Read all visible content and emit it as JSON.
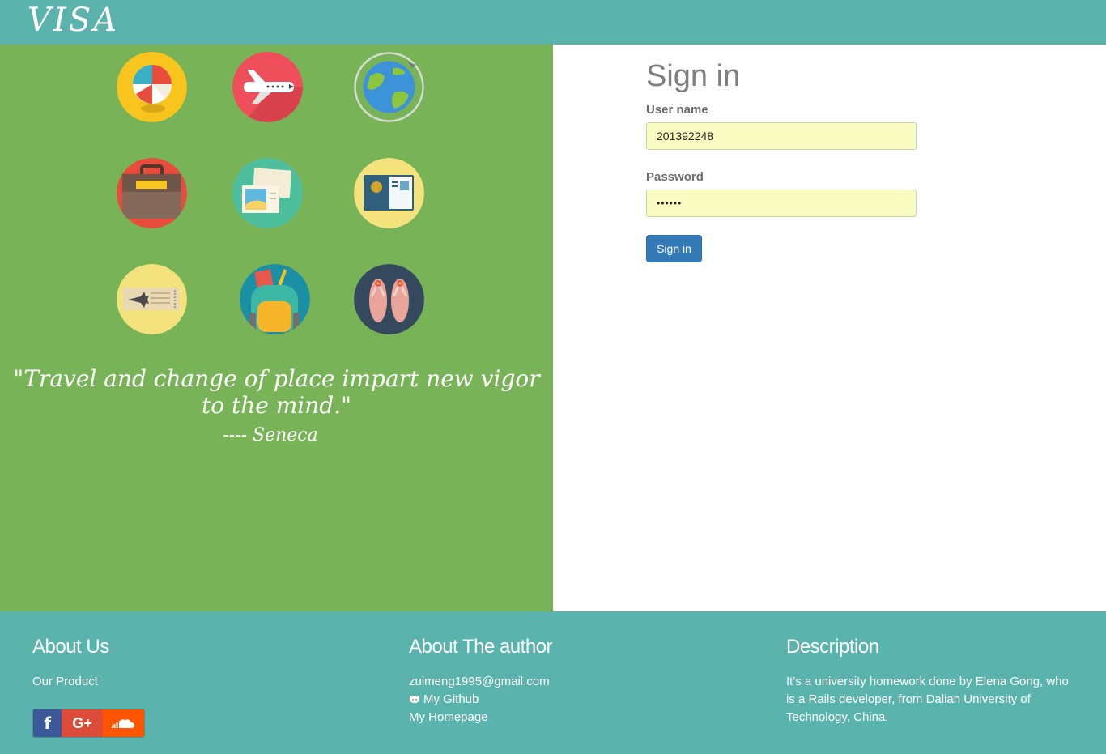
{
  "brand": {
    "logo": "VISA"
  },
  "hero": {
    "icons": [
      "beach-ball-icon",
      "airplane-icon",
      "globe-icon",
      "briefcase-icon",
      "postcard-icon",
      "passport-icon",
      "ticket-icon",
      "backpack-icon",
      "flip-flops-icon"
    ],
    "quote": "\"Travel and change of place impart new vigor to the mind.\"",
    "quote_author": "---- Seneca"
  },
  "signin": {
    "title": "Sign in",
    "username_label": "User name",
    "username_value": "201392248",
    "password_label": "Password",
    "password_value": "••••••",
    "button_label": "Sign in"
  },
  "footer": {
    "about_us": {
      "title": "About Us",
      "link": "Our Product"
    },
    "social": {
      "facebook_glyph": "f",
      "google_glyph": "G+",
      "soundcloud_icon": "soundcloud-icon"
    },
    "author": {
      "title": "About The author",
      "email": "zuimeng1995@gmail.com",
      "github": "My Github",
      "homepage": "My Homepage"
    },
    "description": {
      "title": "Description",
      "line1": "It's a university homework done by Elena Gong, who",
      "line2": "is a Rails developer, from Dalian University of",
      "line3": "Technology, China."
    }
  },
  "colors": {
    "header": "#5ab3ac",
    "left_panel": "#79b358",
    "input_bg": "#fafdc1",
    "button": "#337ab7",
    "facebook": "#3b5998",
    "google": "#dd4b39",
    "soundcloud": "#ff5500"
  }
}
